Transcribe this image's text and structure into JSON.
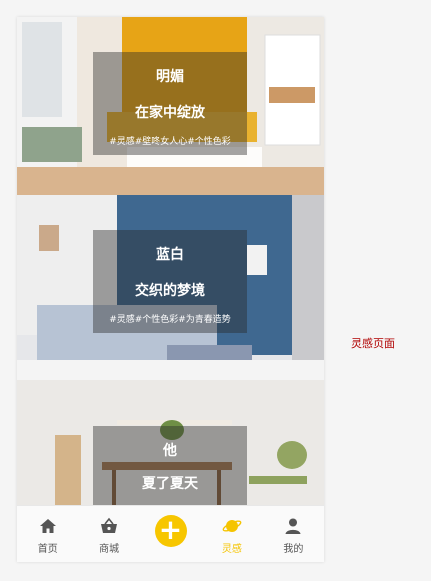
{
  "cards": [
    {
      "title": "明媚",
      "subtitle": "在家中绽放",
      "tags": "#灵感#壁咚女人心#个性色彩"
    },
    {
      "title": "蓝白",
      "subtitle": "交织的梦境",
      "tags": "#灵感#个性色彩#为青春造势"
    },
    {
      "title": "他",
      "subtitle": "夏了夏天",
      "tags": ""
    }
  ],
  "tabbar": {
    "items": [
      {
        "label": "首页",
        "icon": "home-icon"
      },
      {
        "label": "商城",
        "icon": "basket-icon"
      },
      {
        "label": "",
        "icon": "plus-icon"
      },
      {
        "label": "灵感",
        "icon": "planet-icon",
        "active": true
      },
      {
        "label": "我的",
        "icon": "person-icon"
      }
    ]
  },
  "page_label": "灵感页面",
  "colors": {
    "accent": "#f7c600",
    "active_label": "#f5c400",
    "page_label": "#b00000"
  }
}
